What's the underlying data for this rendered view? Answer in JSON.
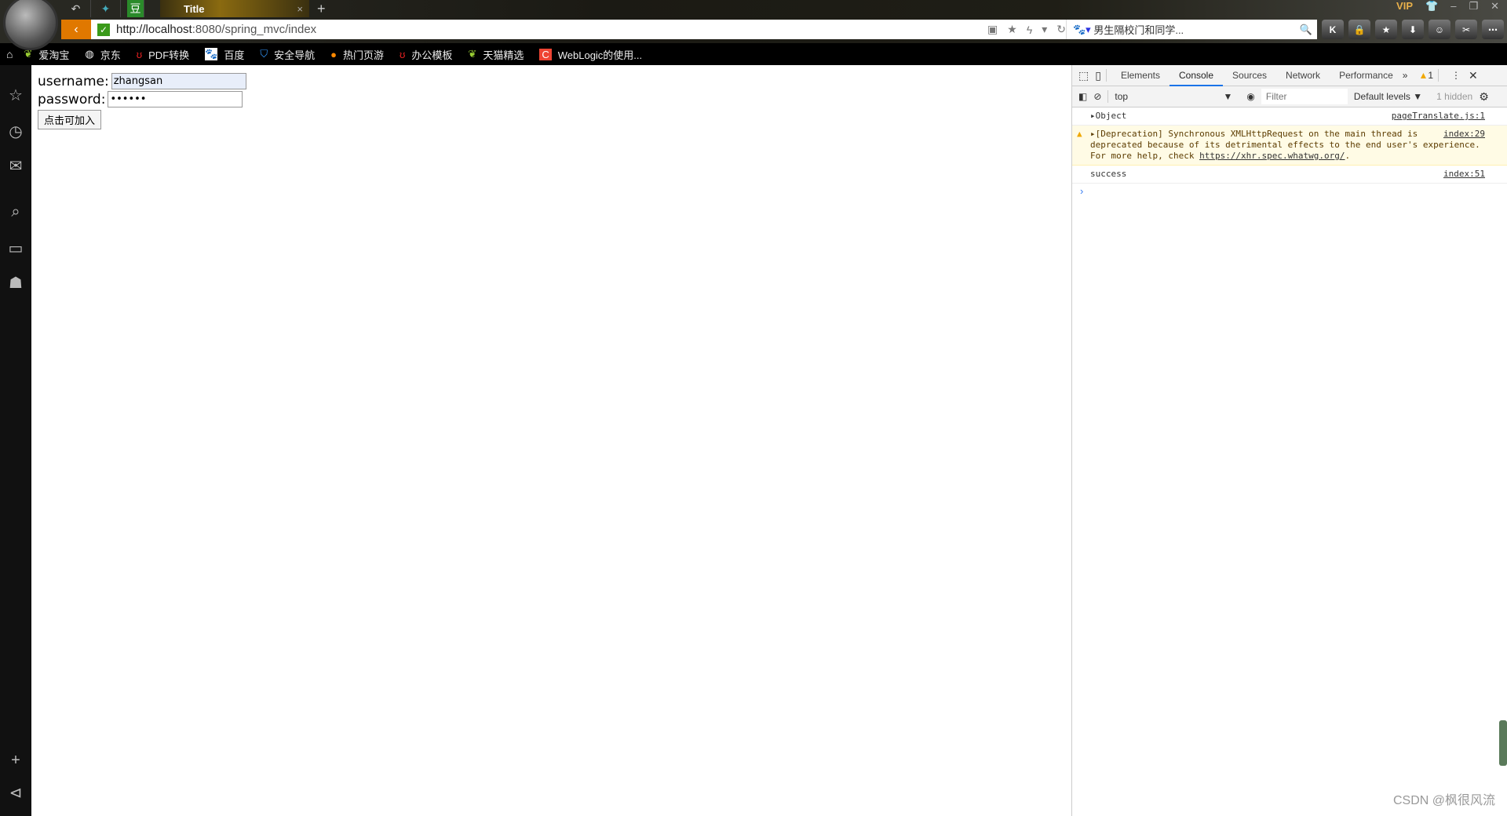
{
  "browser": {
    "tab_title": "Title",
    "url_host": "http://localhost",
    "url_rest": ":8080/spring_mvc/index",
    "search_text": "男生隔校门和同学...",
    "vip": "VIP",
    "tabbar_icons": [
      "back-history-icon",
      "bird-icon",
      "douban-icon"
    ],
    "toolbar_icons": [
      "K",
      "lock",
      "star",
      "download",
      "game",
      "scissors",
      "more"
    ],
    "bookmarks": [
      {
        "icon": "leaf",
        "label": "爱淘宝"
      },
      {
        "icon": "globe",
        "label": "京东"
      },
      {
        "icon": "horns",
        "label": "PDF转换"
      },
      {
        "icon": "paw",
        "label": "百度"
      },
      {
        "icon": "shield",
        "label": "安全导航"
      },
      {
        "icon": "k-circle",
        "label": "热门页游"
      },
      {
        "icon": "horns",
        "label": "办公模板"
      },
      {
        "icon": "leaf",
        "label": "天猫精选"
      },
      {
        "icon": "c",
        "label": "WebLogic的使用..."
      }
    ]
  },
  "form": {
    "username_label": "username:",
    "username_value": "zhangsan",
    "password_label": "password:",
    "password_value": "••••••",
    "submit_label": "点击可加入"
  },
  "devtools": {
    "tabs": [
      "Elements",
      "Console",
      "Sources",
      "Network",
      "Performance"
    ],
    "active_tab": "Console",
    "warning_count": "1",
    "context": "top",
    "filter_placeholder": "Filter",
    "levels": "Default levels ▼",
    "hidden": "1 hidden",
    "messages": [
      {
        "text": "Object",
        "source": "pageTranslate.js:1"
      },
      {
        "text1": "[Deprecation] Synchronous XMLHttpRequest on the main thread is",
        "text2": "deprecated because of its detrimental effects to the end user's experience.",
        "text3": "For more help, check ",
        "link": "https://xhr.spec.whatwg.org/",
        "source": "index:29"
      },
      {
        "text": "success",
        "source": "index:51"
      }
    ]
  },
  "watermark": "CSDN @枫很风流"
}
